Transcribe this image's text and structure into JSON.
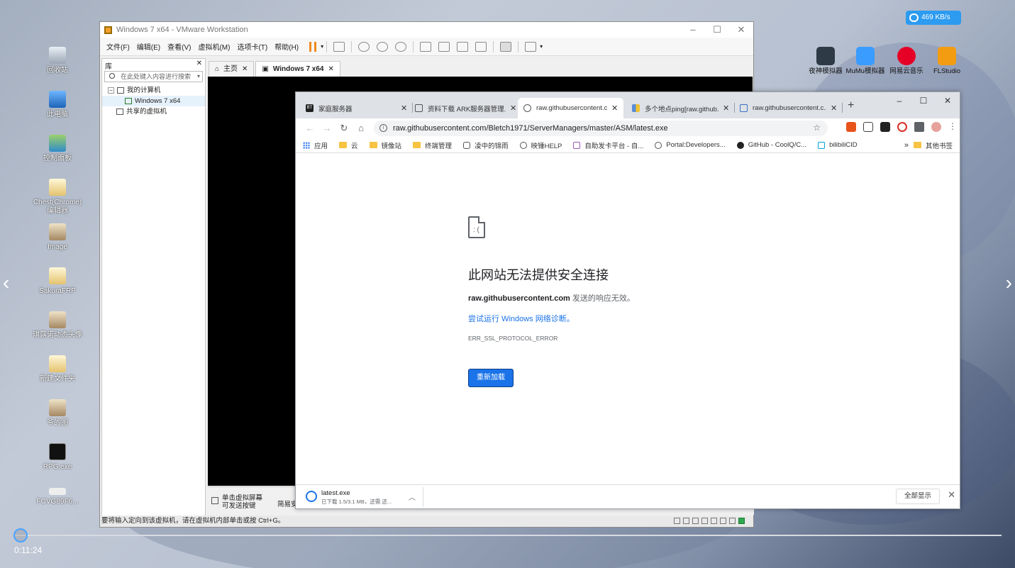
{
  "desktop": {
    "icons": [
      {
        "label": "回收站"
      },
      {
        "label": "此电脑"
      },
      {
        "label": "控制面板"
      },
      {
        "label": "Chest(Chrome)\n编辑器"
      },
      {
        "label": "Image"
      },
      {
        "label": "SakuraFRP"
      },
      {
        "label": "琪露诺动态头像"
      },
      {
        "label": "新建文件夹"
      },
      {
        "label": "爷的图"
      },
      {
        "label": "RPG.exe"
      },
      {
        "label": "FCVG89F6..."
      }
    ],
    "right_apps": [
      {
        "label": "夜神模拟器"
      },
      {
        "label": "MuMu模拟器"
      },
      {
        "label": "网易云音乐"
      },
      {
        "label": "FLStudio"
      }
    ],
    "net_speed": "469 KB/s"
  },
  "vmware": {
    "title": "Windows 7 x64 - VMware Workstation",
    "menu": [
      "文件(F)",
      "编辑(E)",
      "查看(V)",
      "虚拟机(M)",
      "选项卡(T)",
      "帮助(H)"
    ],
    "library": {
      "header": "库",
      "search_placeholder": "在此处键入内容进行搜索",
      "tree": {
        "my_computer": "我的计算机",
        "vm": "Windows 7 x64",
        "shared": "共享的虚拟机"
      }
    },
    "tabs": [
      {
        "label": "主页"
      },
      {
        "label": "Windows 7 x64"
      }
    ],
    "bottom_hint": "单击虚拟屏幕可发送按键",
    "bottom_hint2": "简易安",
    "status_text": "要将输入定向到该虚拟机，请在虚拟机内部单击或按 Ctrl+G。"
  },
  "chrome": {
    "tabs": [
      {
        "label": "家庭服务器"
      },
      {
        "label": "资料下载 ARK服务器管理..."
      },
      {
        "label": "raw.githubusercontent.c..."
      },
      {
        "label": "多个地点ping[raw.github..."
      },
      {
        "label": "raw.githubusercontent.c..."
      }
    ],
    "url": "raw.githubusercontent.com/Bletch1971/ServerManagers/master/ASM/latest.exe",
    "bookmarks": [
      "应用",
      "云",
      "镜像站",
      "终端管理",
      "凌中的锦雨",
      "映锤HELP",
      "自助发卡平台 - 自...",
      "Portal:Developers...",
      "GitHub - CoolQ/C...",
      "bilibiliCID"
    ],
    "bookmarks_more": "»",
    "other_bookmarks": "其他书签",
    "error": {
      "title": "此网站无法提供安全连接",
      "host": "raw.githubusercontent.com",
      "desc_suffix": " 发送的响应无效。",
      "link": "尝试运行 Windows 网络诊断。",
      "code": "ERR_SSL_PROTOCOL_ERROR",
      "reload": "重新加载"
    },
    "download": {
      "filename": "latest.exe",
      "status": "已下载 1.5/3.1 MB，还需 还..."
    },
    "show_all": "全部显示"
  },
  "player": {
    "time": "0:11:24",
    "progress": 0.001
  }
}
